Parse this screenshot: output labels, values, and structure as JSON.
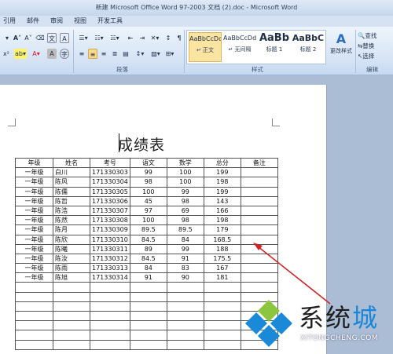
{
  "window": {
    "title": "新建 Microsoft Office Word 97-2003 文档 (2).doc - Microsoft Word"
  },
  "tabs": [
    "引用",
    "邮件",
    "审阅",
    "视图",
    "开发工具"
  ],
  "ribbon": {
    "groups": {
      "paragraph": "段落",
      "styles": "样式",
      "editing": "编辑"
    },
    "styles": [
      {
        "sample": "AaBbCcDd",
        "name": "↵ 正文",
        "selected": true
      },
      {
        "sample": "AaBbCcDd",
        "name": "↵ 无间隔",
        "selected": false
      },
      {
        "sample": "AaBb",
        "name": "标题 1",
        "selected": false
      },
      {
        "sample": "AaBbC",
        "name": "标题 2",
        "selected": false
      }
    ],
    "change_styles": "更改样式",
    "edit": {
      "find": "查找",
      "replace": "替换",
      "select": "选择"
    }
  },
  "document": {
    "title": "成绩表",
    "headers": [
      "年级",
      "姓名",
      "考号",
      "语文",
      "数学",
      "总分",
      "备注"
    ],
    "rows": [
      [
        "一年级",
        "白川",
        "171330303",
        "99",
        "100",
        "199",
        ""
      ],
      [
        "一年级",
        "陈风",
        "171330304",
        "98",
        "100",
        "198",
        ""
      ],
      [
        "一年级",
        "陈儒",
        "171330305",
        "100",
        "99",
        "199",
        ""
      ],
      [
        "一年级",
        "陈哲",
        "171330306",
        "45",
        "98",
        "143",
        ""
      ],
      [
        "一年级",
        "陈浩",
        "171330307",
        "97",
        "69",
        "166",
        ""
      ],
      [
        "一年级",
        "陈然",
        "171330308",
        "100",
        "98",
        "198",
        ""
      ],
      [
        "一年级",
        "陈月",
        "171330309",
        "89.5",
        "89.5",
        "179",
        ""
      ],
      [
        "一年级",
        "陈欣",
        "171330310",
        "84.5",
        "84",
        "168.5",
        ""
      ],
      [
        "一年级",
        "陈曦",
        "171330311",
        "89",
        "99",
        "188",
        ""
      ],
      [
        "一年级",
        "陈汝",
        "171330312",
        "84.5",
        "91",
        "175.5",
        ""
      ],
      [
        "一年级",
        "陈雨",
        "171330313",
        "84",
        "83",
        "167",
        ""
      ],
      [
        "一年级",
        "陈旭",
        "171330314",
        "91",
        "90",
        "181",
        ""
      ]
    ],
    "empty_rows": 7
  },
  "watermark": {
    "brand_a": "系统",
    "brand_b": "城",
    "url": "XITONGCHENG.COM"
  }
}
